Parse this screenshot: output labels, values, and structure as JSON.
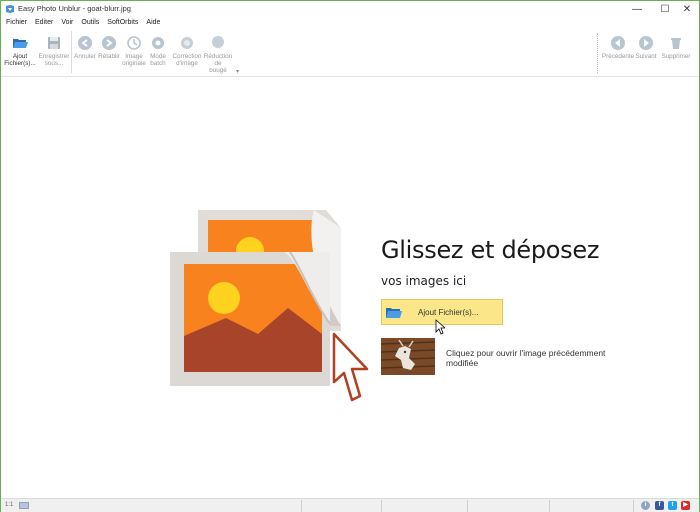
{
  "window": {
    "title": "Easy Photo Unblur - goat-blurr.jpg"
  },
  "window_controls": {
    "minimize": "—",
    "maximize": "☐",
    "close": "✕"
  },
  "menu": {
    "items": [
      {
        "label": "Fichier"
      },
      {
        "label": "Editer"
      },
      {
        "label": "Voir"
      },
      {
        "label": "Outils"
      },
      {
        "label": "SoftOrbits"
      },
      {
        "label": "Aide"
      }
    ]
  },
  "toolbar": {
    "add_files": "Ajout\nFichier(s)...",
    "save_as": "Enregistrer\nsous...",
    "undo": "Annuler",
    "redo": "Rétablir",
    "original_image": "Image\noriginale",
    "batch_mode": "Mode\nbatch",
    "image_correction": "Correction\nd'image",
    "shake_reduction": "Réduction\nde\nbougé",
    "previous": "Précédente",
    "next": "Suivant",
    "delete": "Supprimer"
  },
  "main": {
    "drop_title": "Glissez et déposez",
    "drop_subtitle": "vos images ici",
    "add_button_label": "Ajout Fichier(s)...",
    "recent_text": "Cliquez pour ouvrir l'image précédemment modifiée"
  },
  "colors": {
    "accent_button": "#fbe78a",
    "illustration_orange": "#f7821e",
    "illustration_sun": "#ffd21f",
    "illustration_mountain": "#a8442a",
    "window_border": "#6ab04c"
  },
  "statusbar": {
    "zoom": "1:1",
    "social_icons": [
      "info-icon",
      "facebook-icon",
      "twitter-icon",
      "youtube-icon"
    ]
  }
}
